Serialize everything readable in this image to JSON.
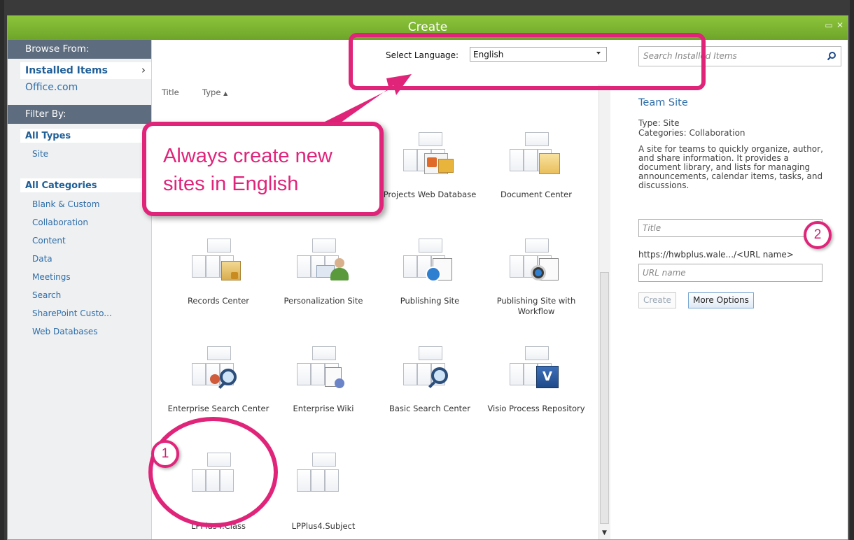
{
  "dialog": {
    "title": "Create"
  },
  "left_nav": {
    "browse_header": "Browse From:",
    "installed": "Installed Items",
    "office": "Office.com",
    "filter_header": "Filter By:",
    "all_types": "All Types",
    "site": "Site",
    "all_categories": "All Categories",
    "categories": [
      "Blank & Custom",
      "Collaboration",
      "Content",
      "Data",
      "Meetings",
      "Search",
      "SharePoint Custo...",
      "Web Databases"
    ]
  },
  "center": {
    "col_title": "Title",
    "col_type": "Type",
    "sort_arrow": "▲",
    "lang_label": "Select Language:",
    "lang_value": "English",
    "tiles": [
      {
        "label": "Projects Web Database"
      },
      {
        "label": "Document Center"
      },
      {
        "label": "Records Center"
      },
      {
        "label": "Personalization Site"
      },
      {
        "label": "Publishing Site"
      },
      {
        "label": "Publishing Site with Workflow"
      },
      {
        "label": "Enterprise Search Center"
      },
      {
        "label": "Enterprise Wiki"
      },
      {
        "label": "Basic Search Center"
      },
      {
        "label": "Visio Process Repository"
      },
      {
        "label": "LPPlus4.Class"
      },
      {
        "label": "LPPlus4.Subject"
      }
    ]
  },
  "right": {
    "search_placeholder": "Search Installed Items",
    "team_title": "Team Site",
    "type_line": "Type: Site",
    "categories_line": "Categories: Collaboration",
    "description": "A site for teams to quickly organize, author, and share information. It provides a document library, and lists for managing announcements, calendar items, tasks, and discussions.",
    "title_placeholder": "Title",
    "url_prefix": "https://hwbplus.wale.../<URL name>",
    "url_placeholder": "URL name",
    "create_button": "Create",
    "more_button": "More Options"
  },
  "annotations": {
    "callout": "Always create new sites in English",
    "badge1": "1",
    "badge2": "2",
    "accent_color": "#e0247a"
  }
}
